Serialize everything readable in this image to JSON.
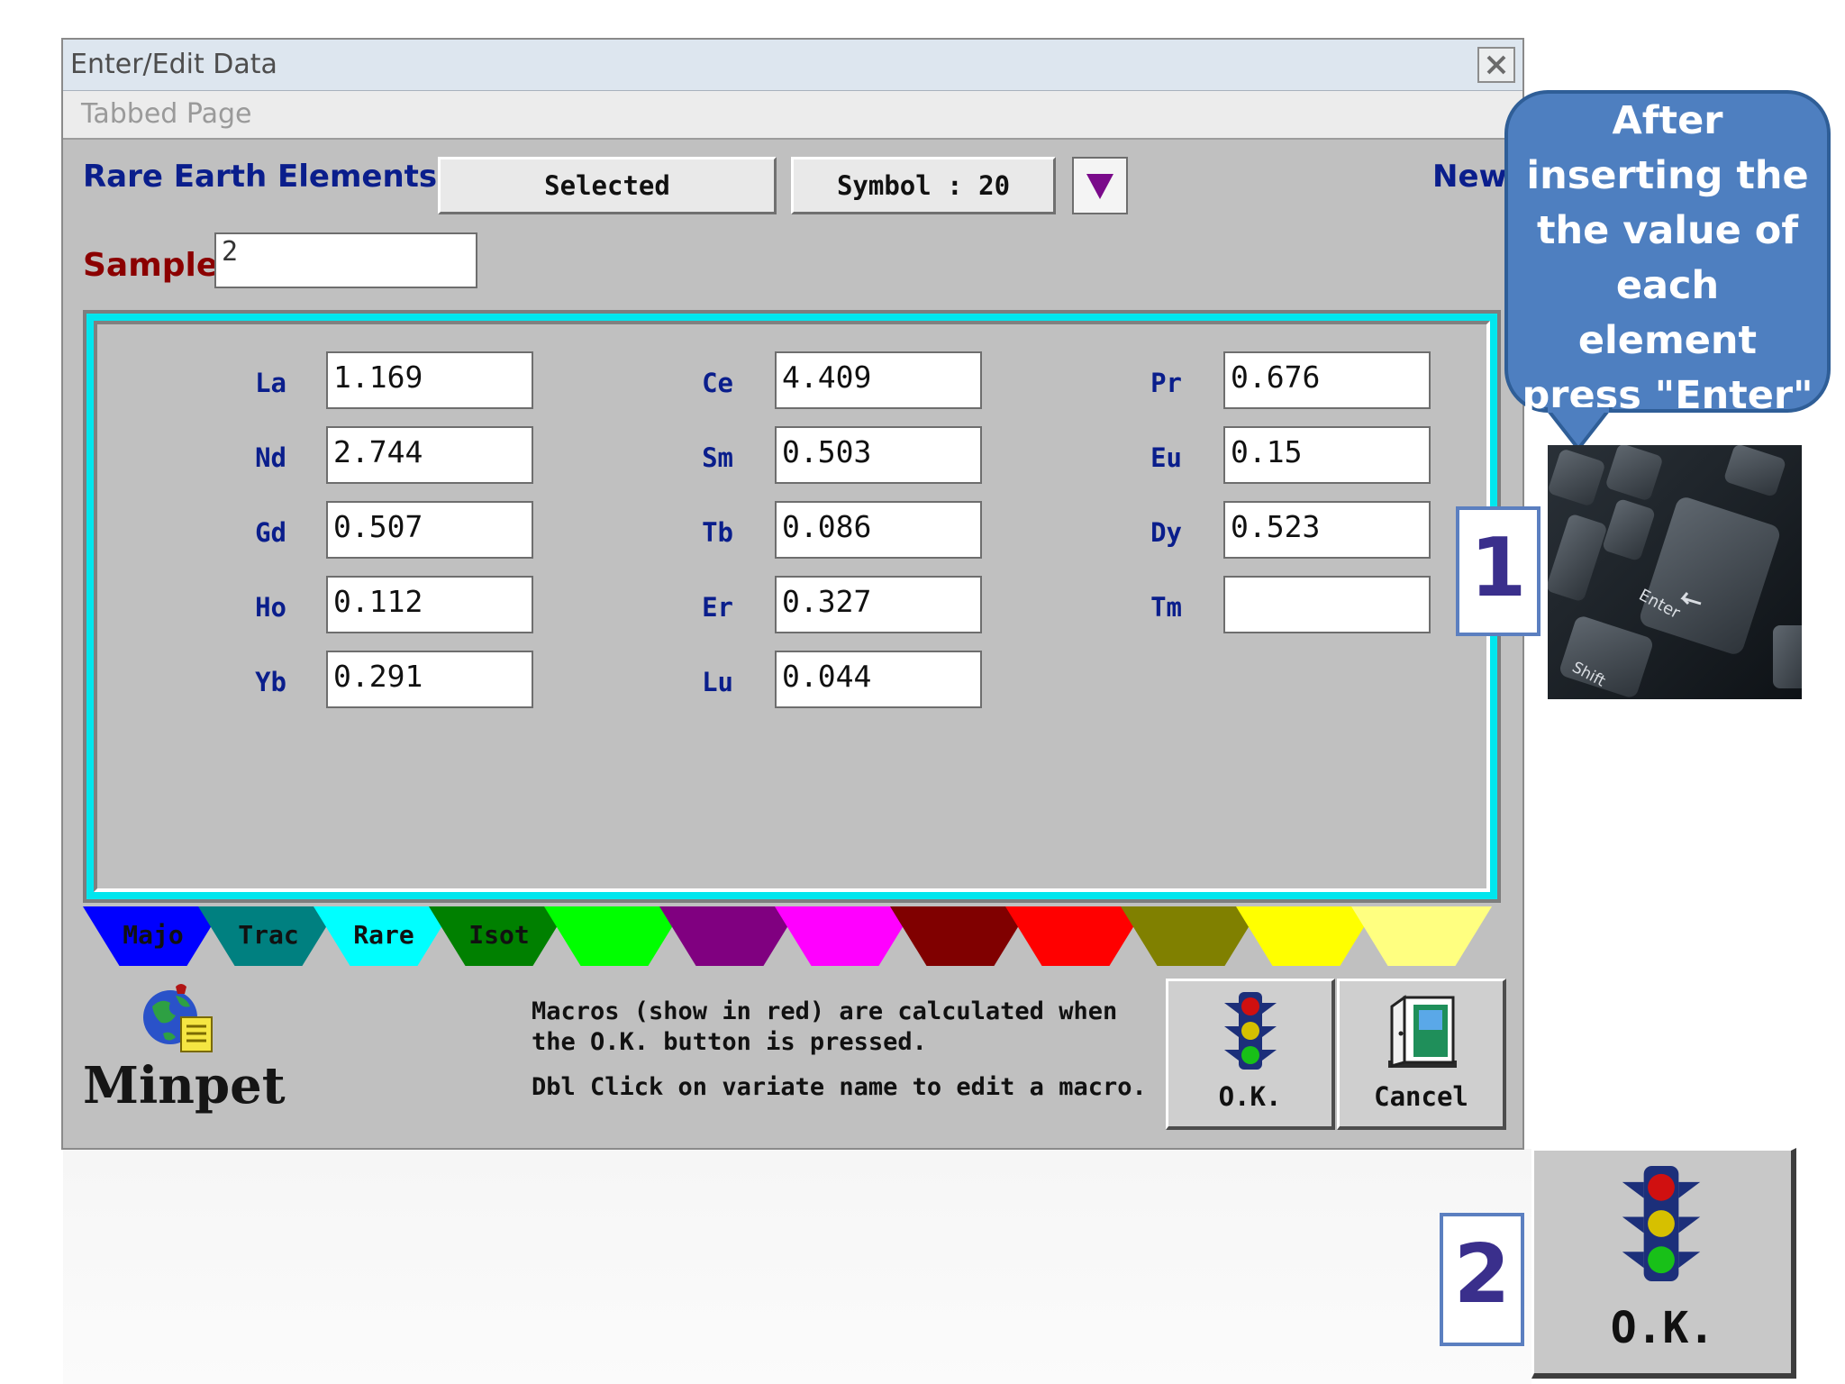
{
  "window": {
    "title": "Enter/Edit Data",
    "menu_item": "Tabbed Page"
  },
  "header": {
    "heading": "Rare Earth Elements",
    "selected_button": "Selected",
    "symbol_button": "Symbol : 20",
    "new_label": "New"
  },
  "sample": {
    "label": "Sample",
    "value": "2"
  },
  "elements": [
    {
      "symbol": "La",
      "value": "1.169"
    },
    {
      "symbol": "Ce",
      "value": "4.409"
    },
    {
      "symbol": "Pr",
      "value": "0.676"
    },
    {
      "symbol": "Nd",
      "value": "2.744"
    },
    {
      "symbol": "Sm",
      "value": "0.503"
    },
    {
      "symbol": "Eu",
      "value": "0.15"
    },
    {
      "symbol": "Gd",
      "value": "0.507"
    },
    {
      "symbol": "Tb",
      "value": "0.086"
    },
    {
      "symbol": "Dy",
      "value": "0.523"
    },
    {
      "symbol": "Ho",
      "value": "0.112"
    },
    {
      "symbol": "Er",
      "value": "0.327"
    },
    {
      "symbol": "Tm",
      "value": ""
    },
    {
      "symbol": "Yb",
      "value": "0.291"
    },
    {
      "symbol": "Lu",
      "value": "0.044"
    }
  ],
  "tabs": [
    {
      "label": "Majo",
      "color": "#0000ff"
    },
    {
      "label": "Trac",
      "color": "#008080"
    },
    {
      "label": "Rare",
      "color": "#00ffff"
    },
    {
      "label": "Isot",
      "color": "#008000"
    },
    {
      "label": "",
      "color": "#00ff00"
    },
    {
      "label": "",
      "color": "#800080"
    },
    {
      "label": "",
      "color": "#ff00ff"
    },
    {
      "label": "",
      "color": "#800000"
    },
    {
      "label": "",
      "color": "#ff0000"
    },
    {
      "label": "",
      "color": "#808000"
    },
    {
      "label": "",
      "color": "#ffff00"
    },
    {
      "label": "",
      "color": "#ffff80"
    }
  ],
  "footer": {
    "logo_text": "Minpet",
    "note_line1": "Macros (show in red) are calculated when",
    "note_line2": "the O.K. button is pressed.",
    "note_line3": "Dbl Click on variate name to edit a macro.",
    "ok_label": "O.K.",
    "cancel_label": "Cancel"
  },
  "annotation": {
    "callout_lines": [
      "After",
      "inserting the",
      "the value of",
      "each",
      "element",
      "press \"Enter\""
    ],
    "step1": "1",
    "step2": "2",
    "zoom_ok_label": "O.K.",
    "keyboard_enter": "Enter",
    "keyboard_shift": "Shift"
  },
  "icons": {
    "close": "close-icon",
    "dropdown": "triangle-down-icon",
    "ok": "traffic-light-icon",
    "cancel": "door-exit-icon",
    "logo": "globe-icon"
  }
}
